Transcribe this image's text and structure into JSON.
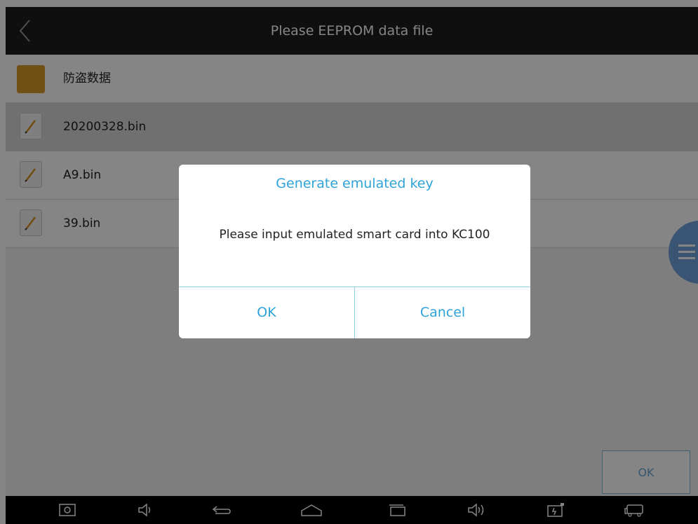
{
  "header": {
    "title": "Please EEPROM data file"
  },
  "files": [
    {
      "name": "防盗数据",
      "type": "folder",
      "selected": false
    },
    {
      "name": "20200328.bin",
      "type": "file",
      "selected": true
    },
    {
      "name": "A9.bin",
      "type": "file",
      "selected": false
    },
    {
      "name": "39.bin",
      "type": "file",
      "selected": false
    }
  ],
  "footer": {
    "ok_label": "OK"
  },
  "dialog": {
    "title": "Generate emulated key",
    "message": "Please input emulated smart card into KC100",
    "ok_label": "OK",
    "cancel_label": "Cancel"
  },
  "nav_icons": [
    "screenshot-icon",
    "volume-down-icon",
    "back-icon",
    "home-icon",
    "recent-apps-icon",
    "volume-up-icon",
    "battery-icon",
    "vehicle-icon"
  ],
  "colors": {
    "accent": "#2ea3d9",
    "folder": "#d99a2b",
    "side_tab": "#6fa3dc"
  }
}
